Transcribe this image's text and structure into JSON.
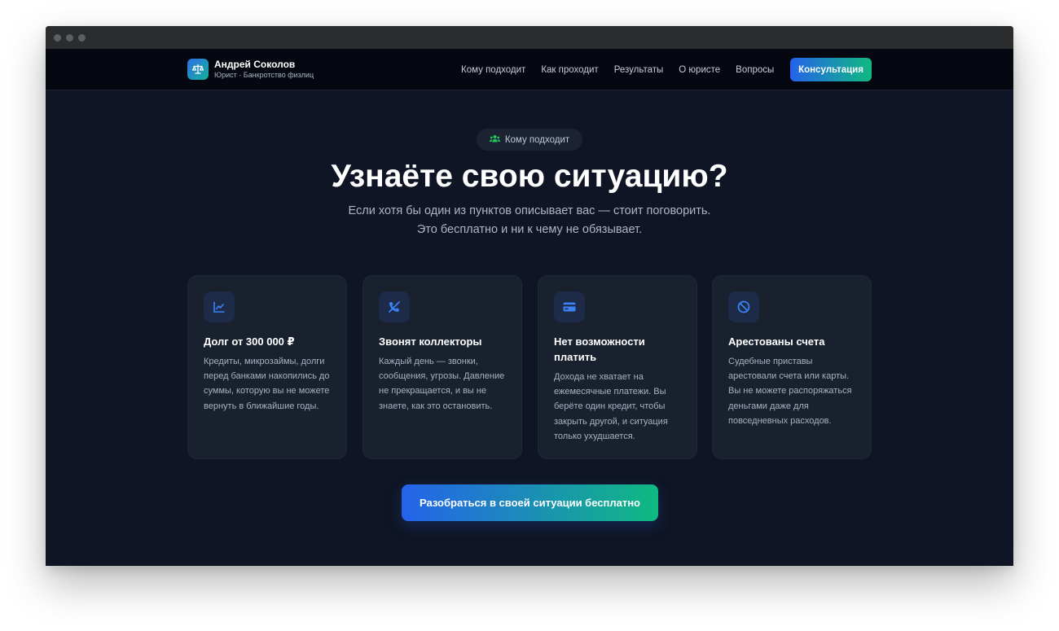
{
  "brand": {
    "name": "Андрей Соколов",
    "subtitle": "Юрист · Банкротство физлиц"
  },
  "nav": {
    "links": [
      "Кому подходит",
      "Как проходит",
      "Результаты",
      "О юристе",
      "Вопросы"
    ],
    "cta_label": "Консультация"
  },
  "section": {
    "badge": "Кому подходит",
    "title": "Узнаёте свою ситуацию?",
    "subtitle_line1": "Если хотя бы один из пунктов описывает вас — стоит поговорить.",
    "subtitle_line2": "Это бесплатно и ни к чему не обязывает."
  },
  "cards": [
    {
      "icon": "chart-line-icon",
      "title": "Долг от 300 000 ₽",
      "text": "Кредиты, микрозаймы, долги перед банками накопились до суммы, которую вы не можете вернуть в ближайшие годы."
    },
    {
      "icon": "phone-slash-icon",
      "title": "Звонят коллекторы",
      "text": "Каждый день — звонки, сообщения, угрозы. Давление не прекращается, и вы не знаете, как это остановить."
    },
    {
      "icon": "credit-card-icon",
      "title": "Нет возможности платить",
      "text": "Дохода не хватает на ежемесячные платежи. Вы берёте один кредит, чтобы закрыть другой, и ситуация только ухудшается."
    },
    {
      "icon": "ban-icon",
      "title": "Арестованы счета",
      "text": "Судебные приставы арестовали счета или карты. Вы не можете распоряжаться деньгами даже для повседневных расходов."
    }
  ],
  "cta_main": "Разобраться в своей ситуации бесплатно",
  "colors": {
    "background": "#0f1524",
    "card": "#19212f",
    "accent_blue": "#2563eb",
    "accent_green": "#10b981"
  }
}
